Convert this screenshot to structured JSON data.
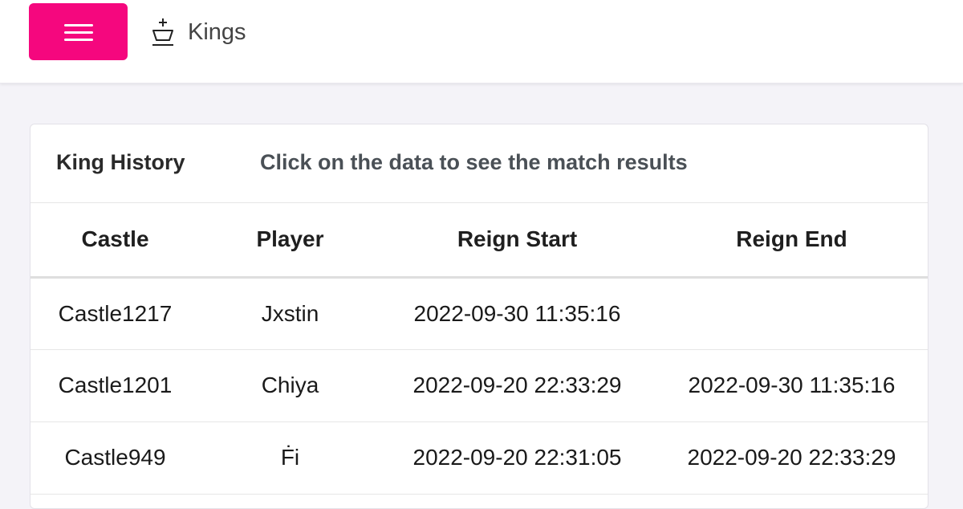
{
  "header": {
    "menu_icon": "hamburger-menu-icon",
    "brand_icon": "chess-king-icon",
    "title": "Kings",
    "accent_color": "#f5077e"
  },
  "card": {
    "title": "King History",
    "hint": "Click on the data to see the match results",
    "columns": [
      "Castle",
      "Player",
      "Reign Start",
      "Reign End"
    ],
    "rows": [
      {
        "castle": "Castle1217",
        "player": "Jxstin",
        "reign_start": "2022-09-30 11:35:16",
        "reign_end": ""
      },
      {
        "castle": "Castle1201",
        "player": "Chiya",
        "reign_start": "2022-09-20 22:33:29",
        "reign_end": "2022-09-30 11:35:16"
      },
      {
        "castle": "Castle949",
        "player": "Ḟi",
        "reign_start": "2022-09-20 22:31:05",
        "reign_end": "2022-09-20 22:33:29"
      }
    ]
  }
}
